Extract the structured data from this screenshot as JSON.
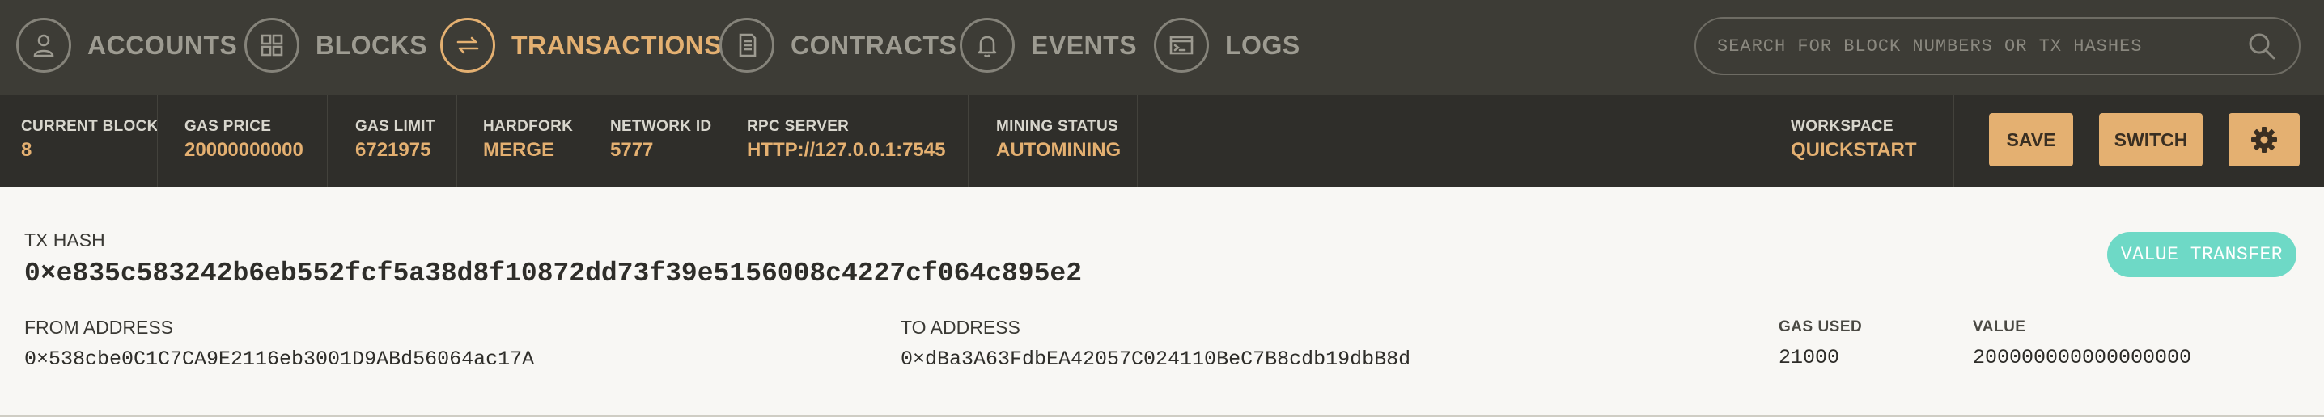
{
  "nav": {
    "items": [
      {
        "label": "ACCOUNTS",
        "icon": "user-icon",
        "active": false
      },
      {
        "label": "BLOCKS",
        "icon": "blocks-grid-icon",
        "active": false
      },
      {
        "label": "TRANSACTIONS",
        "icon": "transfer-arrows-icon",
        "active": true
      },
      {
        "label": "CONTRACTS",
        "icon": "document-icon",
        "active": false
      },
      {
        "label": "EVENTS",
        "icon": "bell-icon",
        "active": false
      },
      {
        "label": "LOGS",
        "icon": "terminal-icon",
        "active": false
      }
    ],
    "search_placeholder": "SEARCH FOR BLOCK NUMBERS OR TX HASHES"
  },
  "status": {
    "current_block": {
      "label": "CURRENT BLOCK",
      "value": "8"
    },
    "gas_price": {
      "label": "GAS PRICE",
      "value": "20000000000"
    },
    "gas_limit": {
      "label": "GAS LIMIT",
      "value": "6721975"
    },
    "hardfork": {
      "label": "HARDFORK",
      "value": "MERGE"
    },
    "network_id": {
      "label": "NETWORK ID",
      "value": "5777"
    },
    "rpc_server": {
      "label": "RPC SERVER",
      "value": "HTTP://127.0.0.1:7545"
    },
    "mining_status": {
      "label": "MINING STATUS",
      "value": "AUTOMINING"
    },
    "workspace": {
      "label": "WORKSPACE",
      "value": "QUICKSTART"
    },
    "save_label": "SAVE",
    "switch_label": "SWITCH"
  },
  "transaction": {
    "hash_label": "TX HASH",
    "hash": "0×e835c583242b6eb552fcf5a38d8f10872dd73f39e5156008c4227cf064c895e2",
    "type_badge": "VALUE TRANSFER",
    "from_label": "FROM ADDRESS",
    "from": "0×538cbe0C1C7CA9E2116eb3001D9ABd56064ac17A",
    "to_label": "TO ADDRESS",
    "to": "0×dBa3A63FdbEA42057C024110BeC7B8cdb19dbB8d",
    "gas_used_label": "GAS USED",
    "gas_used": "21000",
    "value_label": "VALUE",
    "value": "200000000000000000"
  },
  "colors": {
    "accent": "#e4b071",
    "nav_bg": "#3d3c36",
    "status_bg": "#2f2e2a",
    "badge": "#6ed9c6"
  }
}
